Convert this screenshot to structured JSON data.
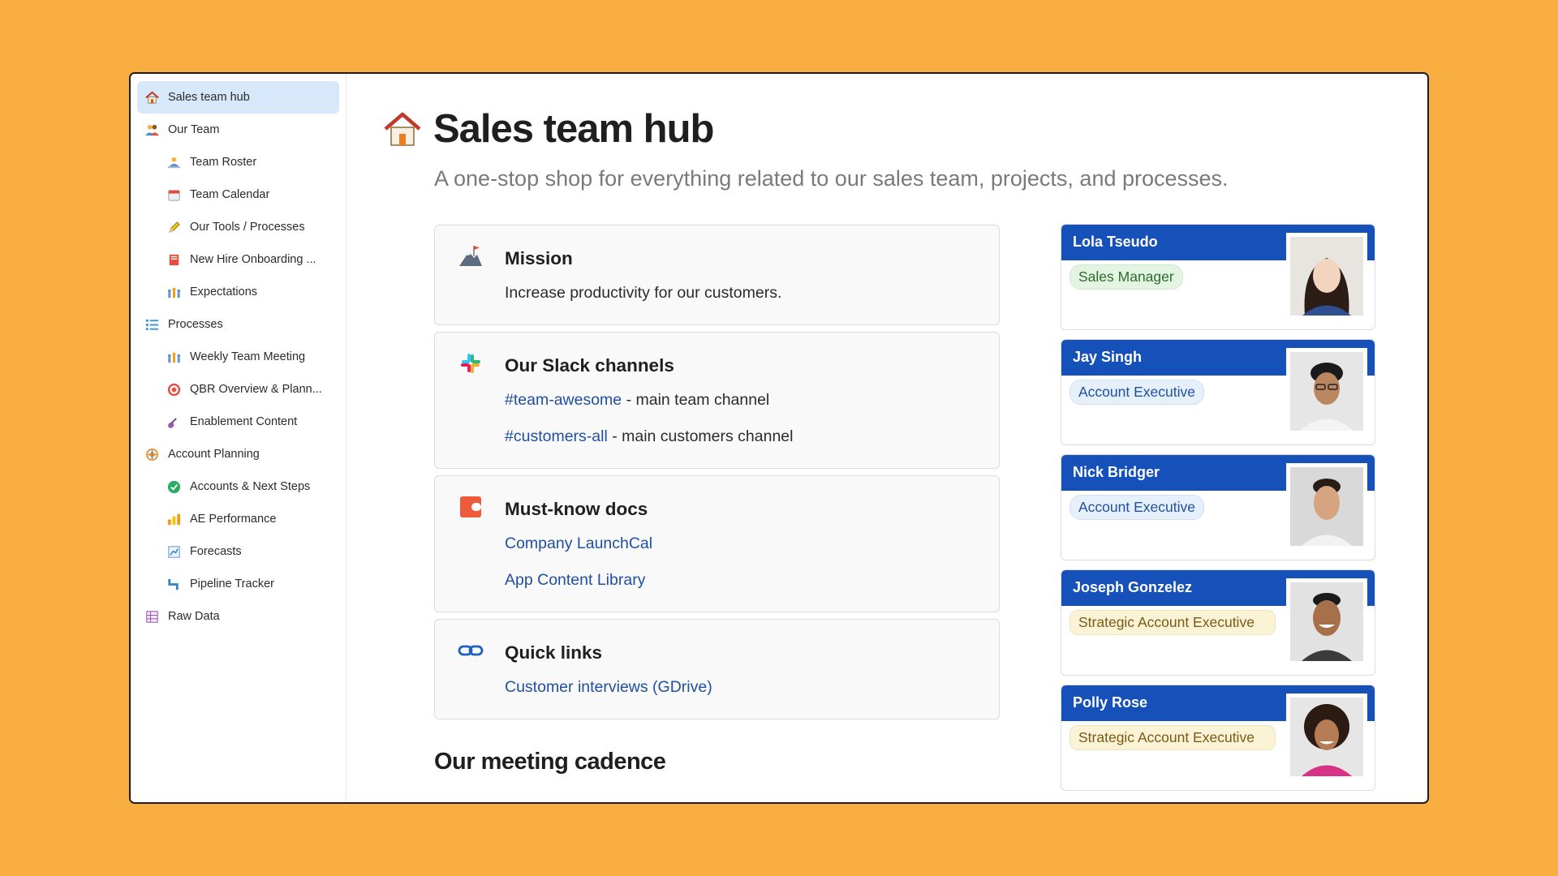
{
  "sidebar": {
    "items": [
      {
        "label": "Sales team hub",
        "icon": "house-icon",
        "level": 0,
        "active": true
      },
      {
        "label": "Our Team",
        "icon": "people-icon",
        "level": 0
      },
      {
        "label": "Team Roster",
        "icon": "people-icon",
        "level": 1
      },
      {
        "label": "Team Calendar",
        "icon": "calendar-icon",
        "level": 1
      },
      {
        "label": "Our Tools / Processes",
        "icon": "pencil-icon",
        "level": 1
      },
      {
        "label": "New Hire Onboarding ...",
        "icon": "book-icon",
        "level": 1
      },
      {
        "label": "Expectations",
        "icon": "crowd-icon",
        "level": 1
      },
      {
        "label": "Processes",
        "icon": "list-icon",
        "level": 0
      },
      {
        "label": "Weekly Team Meeting",
        "icon": "crowd-icon",
        "level": 1
      },
      {
        "label": "QBR Overview & Plann...",
        "icon": "target-icon",
        "level": 1
      },
      {
        "label": "Enablement Content",
        "icon": "guitar-icon",
        "level": 1
      },
      {
        "label": "Account Planning",
        "icon": "compass-icon",
        "level": 0
      },
      {
        "label": "Accounts & Next Steps",
        "icon": "check-icon",
        "level": 1
      },
      {
        "label": "AE Performance",
        "icon": "bar-chart-icon",
        "level": 1
      },
      {
        "label": "Forecasts",
        "icon": "trend-chart-icon",
        "level": 1
      },
      {
        "label": "Pipeline Tracker",
        "icon": "pipe-icon",
        "level": 1
      },
      {
        "label": "Raw Data",
        "icon": "table-icon",
        "level": 0
      }
    ]
  },
  "page": {
    "title": "Sales team hub",
    "title_icon": "house-icon",
    "subtitle": "A one-stop shop for everything related to our sales team, projects, and processes."
  },
  "cards": {
    "mission": {
      "title": "Mission",
      "icon": "mountain-flag-icon",
      "text": "Increase productivity for our customers."
    },
    "slack": {
      "title": "Our Slack channels",
      "icon": "slack-icon",
      "channels": [
        {
          "link": "#team-awesome",
          "desc": " - main team channel"
        },
        {
          "link": "#customers-all",
          "desc": " - main customers channel"
        }
      ]
    },
    "docs": {
      "title": "Must-know docs",
      "icon": "coda-icon",
      "links": [
        "Company LaunchCal",
        "App Content Library"
      ]
    },
    "quick": {
      "title": "Quick links",
      "icon": "link-icon",
      "links": [
        "Customer interviews (GDrive)"
      ]
    }
  },
  "section_heading": "Our meeting cadence",
  "team": [
    {
      "name": "Lola Tseudo",
      "role": "Sales Manager",
      "role_color": "green"
    },
    {
      "name": "Jay Singh",
      "role": "Account Executive",
      "role_color": "blue"
    },
    {
      "name": "Nick Bridger",
      "role": "Account Executive",
      "role_color": "blue"
    },
    {
      "name": "Joseph Gonzelez",
      "role": "Strategic Account Executive",
      "role_color": "yellow"
    },
    {
      "name": "Polly Rose",
      "role": "Strategic Account Executive",
      "role_color": "yellow"
    }
  ],
  "colors": {
    "background": "#F8AE40",
    "accent_blue": "#1651B9",
    "link": "#1F4FA3",
    "active_nav": "#D6E8FA"
  }
}
